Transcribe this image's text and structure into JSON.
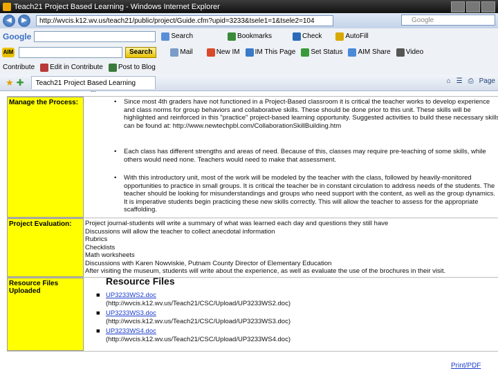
{
  "window": {
    "title": "Teach21 Project Based Learning - Windows Internet Explorer"
  },
  "address_bar": {
    "url": "http://wvcis.k12.wv.us/teach21/public/project/Guide.cfm?upid=3233&tsele1=1&tsele2=104",
    "search_placeholder": "Google"
  },
  "google_toolbar": {
    "logo": "Google",
    "search_label": "Search",
    "bookmarks_label": "Bookmarks",
    "check_label": "Check",
    "autofill_label": "AutoFill"
  },
  "aim_toolbar": {
    "logo": "AIM",
    "search_label": "Search",
    "mail_label": "Mail",
    "new_im_label": "New IM",
    "im_page_label": "IM This Page",
    "status_label": "Set Status",
    "share_label": "AIM Share",
    "video_label": "Video"
  },
  "contribute_bar": {
    "contribute_label": "Contribute",
    "edit_label": "Edit in Contribute",
    "post_label": "Post to Blog"
  },
  "tabs": {
    "active_tab": "Teach21 Project Based Learning",
    "page_label": "Page"
  },
  "rows": {
    "manage": {
      "label": "Manage the Process:",
      "bullets": [
        "Since most 4th graders have not functioned in a Project-Based classroom it is critical the teacher works to develop experience and class norms for group behaviors and collaborative skills. These should be done prior to this unit. These skills will be highlighted and reinforced in this \"practice\" project-based learning opportunity. Suggested activities to build these necessary skills can be found at: http://www.newtechpbl.com/CollaborationSkillBuilding.htm",
        "Each class has different strengths and areas of need. Because of this, classes may require pre-teaching of some skills, while others would need none. Teachers would need to make that assessment.",
        "With this introductory unit, most of the work will be modeled by the teacher with the class, followed by heavily-monitored opportunities to practice in small groups. It is critical the teacher be in constant circulation to address needs of the students. The teacher should be looking for misunderstandings and groups who need support with the content, as well as the group dynamics. It is imperative students begin practicing these new skills correctly. This will allow the teacher to assess for the appropriate scaffolding."
      ]
    },
    "evaluation": {
      "label": "Project Evaluation:",
      "lines": [
        "Project journal-students will write a summary of what was learned each day and questions they still have",
        "Discussions will allow the teacher to collect anecdotal information",
        "Rubrics",
        "Checklists",
        "Math worksheets",
        "Discussions with Karen Nowviskie, Putnam County Director of Elementary Education",
        "After visiting the museum, students will write about the experience, as well as evaluate the use of the brochures in their visit."
      ]
    },
    "resources": {
      "label": "Resource Files Uploaded",
      "heading": "Resource Files",
      "files": [
        {
          "name": "UP3233WS2.doc",
          "path": "(http://wvcis.k12.wv.us/Teach21/CSC/Upload/UP3233WS2.doc)"
        },
        {
          "name": "UP3233WS3.doc",
          "path": "(http://wvcis.k12.wv.us/Teach21/CSC/Upload/UP3233WS3.doc)"
        },
        {
          "name": "UP3233WS4.doc",
          "path": "(http://wvcis.k12.wv.us/Teach21/CSC/Upload/UP3233WS4.doc)"
        }
      ]
    }
  },
  "footer": {
    "print_label": "Print/PDF"
  }
}
